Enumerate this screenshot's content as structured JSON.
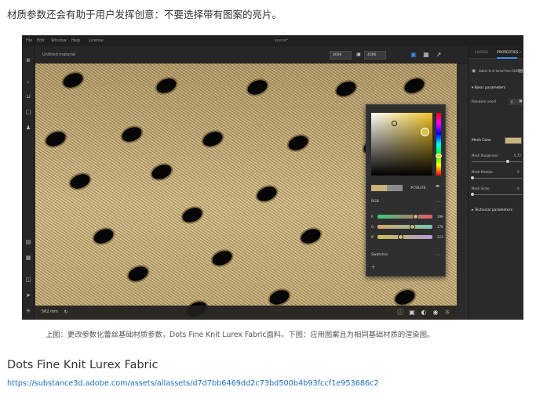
{
  "intro_text": "材质参数还会有助于用户发挥创意：不要选择带有图案的亮片。",
  "app": {
    "menu": [
      "File",
      "Edit",
      "Window",
      "Help",
      "License"
    ],
    "document_title": "scene*",
    "viewport_tab": "Untitled material",
    "toolbar": {
      "width_value": "4096",
      "height_value": "4096",
      "icons": [
        "camera-icon",
        "frame-icon",
        "expand-icon"
      ]
    },
    "left_tools": [
      "plus-icon",
      "crop-icon",
      "bracket-icon",
      "square-icon",
      "person-icon",
      "archive-icon",
      "briefcase-icon",
      "screen-icon",
      "pointer-icon",
      "asterisk-icon"
    ],
    "status": {
      "resolution_label": "562 mm"
    }
  },
  "color_picker": {
    "current_color": "#c9b37d",
    "new_color": "#8c8c8c",
    "hex_value": "#C9B37B",
    "mode": "RGB",
    "sliders": [
      {
        "label": "R",
        "value": "199"
      },
      {
        "label": "G",
        "value": "178"
      },
      {
        "label": "B",
        "value": "123"
      }
    ],
    "swatches_label": "Swatches",
    "add_label": "+"
  },
  "right_panel": {
    "tabs": [
      "LAYERS",
      "PROPERTIES"
    ],
    "material_name": "fabric-knit-lurex-fine-004E",
    "basic_section": "Basic parameters",
    "random_seed_label": "Random seed",
    "random_seed_value": "0",
    "mesh_color_label": "Mesh Color",
    "mesh_roughness_label": "Mesh Roughness",
    "mesh_roughness_value": "0.72",
    "mesh_metallic_label": "Mesh Metallic",
    "mesh_metallic_value": "0",
    "mesh_scale_label": "Mesh Scale",
    "mesh_scale_value": "0",
    "technical_section": "Technical parameters"
  },
  "caption": "上图：更改参数化蕾丝基础材质参数，Dots Fine Knit Lurex Fabric面料。下图：应用图案且为相同基础材质的渲染图。",
  "asset_title": "Dots Fine Knit Lurex Fabric",
  "asset_link": "https://substance3d.adobe.com/assets/allassets/d7d7bb6469dd2c73bd500b4b93fccf1e953686c2",
  "colors": {
    "fabric": "#c9b27e",
    "accent": "#3b8ee8",
    "link": "#1a6fc4"
  }
}
